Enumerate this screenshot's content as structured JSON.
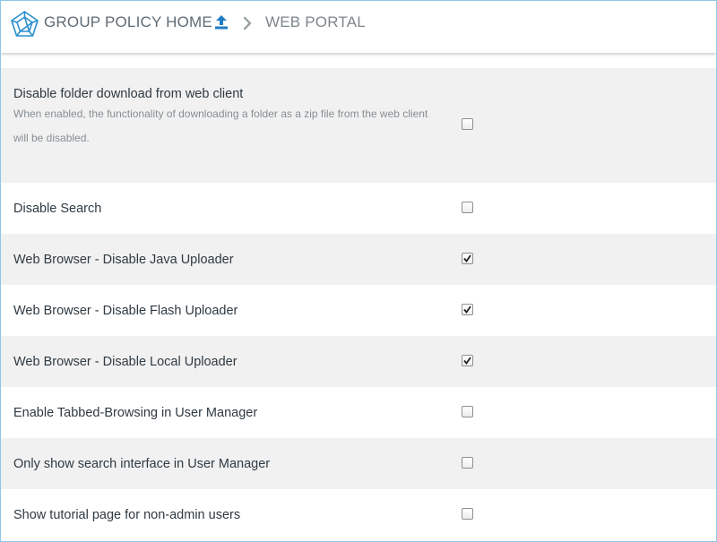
{
  "header": {
    "home_label": "GROUP POLICY HOME",
    "current_label": "WEB PORTAL",
    "logo_color": "#2a8fcf",
    "up_icon_color": "#1f7dc4"
  },
  "settings": [
    {
      "label": "Disable folder download from web client",
      "description": "When enabled, the functionality of downloading a folder as a zip file from the web client will be disabled.",
      "checked": false
    },
    {
      "label": "Disable Search",
      "checked": false
    },
    {
      "label": "Web Browser - Disable Java Uploader",
      "checked": true
    },
    {
      "label": "Web Browser - Disable Flash Uploader",
      "checked": true
    },
    {
      "label": "Web Browser - Disable Local Uploader",
      "checked": true
    },
    {
      "label": "Enable Tabbed-Browsing in User Manager",
      "checked": false
    },
    {
      "label": "Only show search interface in User Manager",
      "checked": false
    },
    {
      "label": "Show tutorial page for non-admin users",
      "checked": false
    }
  ]
}
